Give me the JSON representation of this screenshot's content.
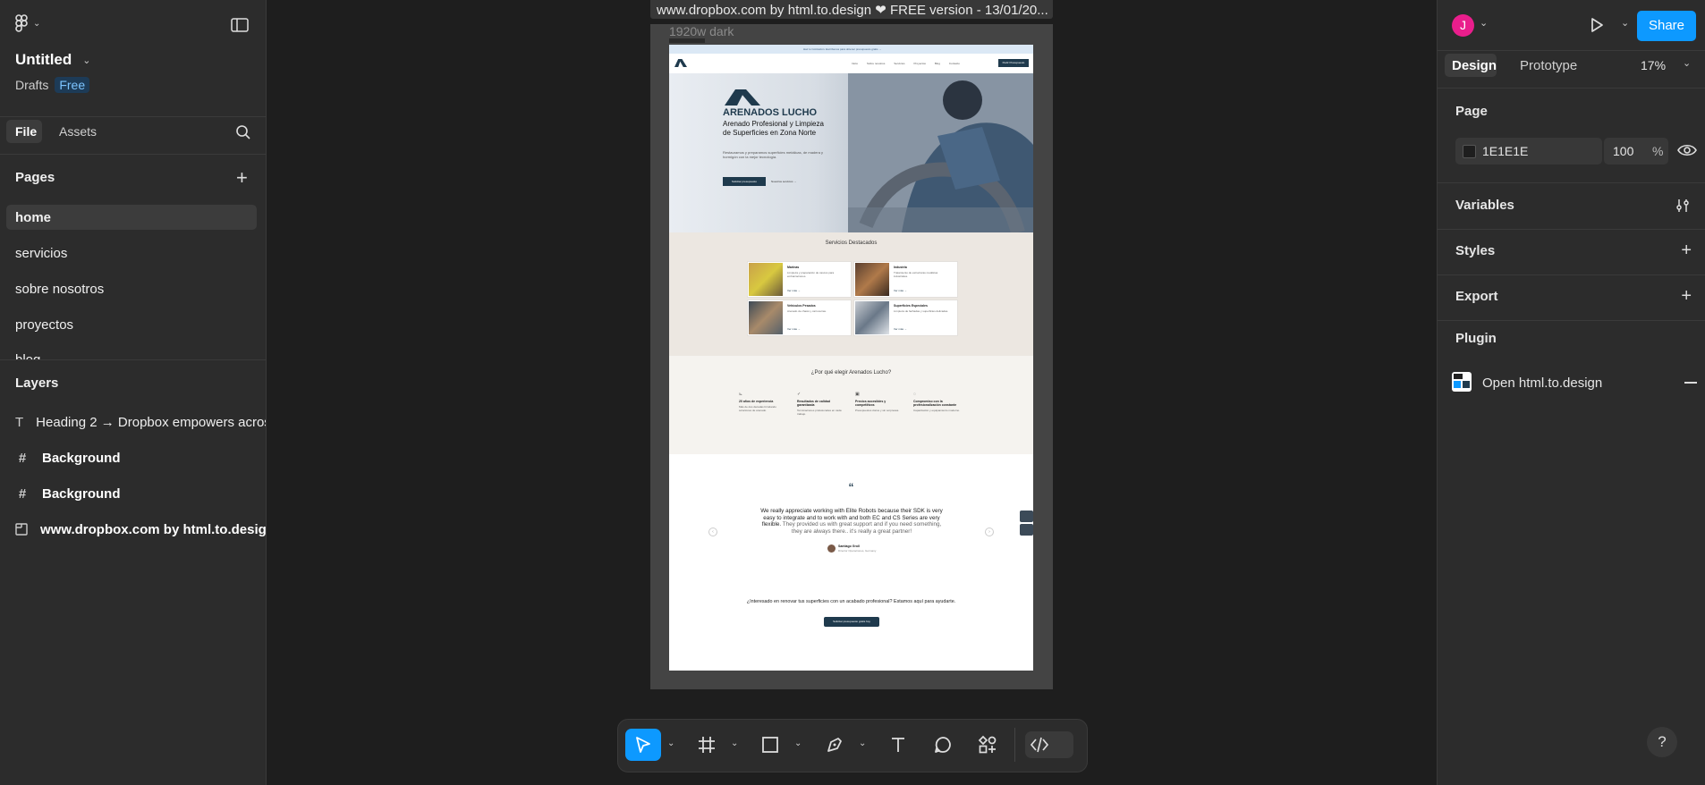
{
  "app": {
    "file_name": "Untitled",
    "location": "Drafts",
    "plan_badge": "Free",
    "user_initial": "J",
    "share_label": "Share",
    "help_label": "?"
  },
  "left_panel": {
    "tabs": [
      "File",
      "Assets"
    ],
    "pages_title": "Pages",
    "pages": [
      "home",
      "servicios",
      "sobre nosotros",
      "proyectos",
      "blog"
    ],
    "layers_title": "Layers",
    "layers": [
      {
        "icon": "text-layer-icon",
        "label": "Heading 2 → Dropbox empowers acros"
      },
      {
        "icon": "frame-layer-icon",
        "label": "Background"
      },
      {
        "icon": "frame-layer-icon",
        "label": "Background"
      },
      {
        "icon": "section-layer-icon",
        "label": "www.dropbox.com by html.to.design"
      }
    ]
  },
  "canvas": {
    "frame_title": "www.dropbox.com by html.to.design ❤ FREE version - 13/01/20...",
    "frame_sublabel": "1920w dark",
    "site": {
      "top_banner": "Haz tu Cotización. Escríbenos para obtener presupuesto gratis →",
      "nav": [
        "Inicio",
        "Sobre nosotros",
        "Servicios",
        "Proyectos",
        "Blog",
        "Contacto"
      ],
      "nav_cta": "Pedir Presupuesto",
      "brand": "ARENADOS LUCHO",
      "hero_title": "Arenado Profesional y Limpieza de Superficies en Zona Norte",
      "hero_text": "Restauramos y preparamos superficies metálicas, de madera y hormigón con la mejor tecnología.",
      "hero_btn_primary": "Solicitar presupuesto",
      "hero_btn_secondary": "Nuestros servicios →",
      "services_title": "Servicios Destacados",
      "services": [
        {
          "title": "Marinas",
          "text": "Limpieza y preparación de cascos para embarcaciones.",
          "link": "Ver más →"
        },
        {
          "title": "Industria",
          "text": "Tratamiento de estructuras metálicas industriales.",
          "link": "Ver más →"
        },
        {
          "title": "Vehículos Pesados",
          "text": "Arenado de chasis y carrocerías.",
          "link": "Ver más →"
        },
        {
          "title": "Superficies Especiales",
          "text": "Limpieza de fachadas y superficies delicadas.",
          "link": "Ver más →"
        }
      ],
      "why_title": "¿Por qué elegir Arenados Lucho?",
      "why": [
        {
          "title": "20 años de experiencia",
          "text": "Más de dos décadas brindando soluciones de arenado."
        },
        {
          "title": "Resultados de calidad garantizada",
          "text": "Terminaciones profesionales en cada trabajo."
        },
        {
          "title": "Precios accesibles y competitivos",
          "text": "Presupuestos claros y sin sorpresas."
        },
        {
          "title": "Compromiso con la profesionalización constante",
          "text": "Capacitación y equipamiento moderno."
        }
      ],
      "testimonial_a": "We really appreciate working with Elite Robots because their SDK is very easy to integrate and to work with and both EC and CS Series are very flexible.",
      "testimonial_b": " They provided us with great support and if you need something, they are always there.. it's really a great partner!",
      "author_name": "Santiago Groll",
      "author_role": "Director Operaciones, Germany",
      "cta_text": "¿Interesado en renovar tus superficies con un acabado profesional? Estamos aquí para ayudarte.",
      "cta_button": "Solicitar presupuesto gratis hoy"
    }
  },
  "right_panel": {
    "tabs": [
      "Design",
      "Prototype"
    ],
    "zoom": "17%",
    "page_title": "Page",
    "page_color": "1E1E1E",
    "page_opacity": "100",
    "opacity_unit": "%",
    "sections": [
      "Variables",
      "Styles",
      "Export"
    ],
    "plugin_title": "Plugin",
    "plugin_name": "Open html.to.design"
  },
  "colors": {
    "accent": "#0d99ff",
    "avatar": "#e91e8c",
    "site_navy": "#1f3a4d",
    "panel": "#2c2c2c",
    "canvas": "#1e1e1e"
  }
}
